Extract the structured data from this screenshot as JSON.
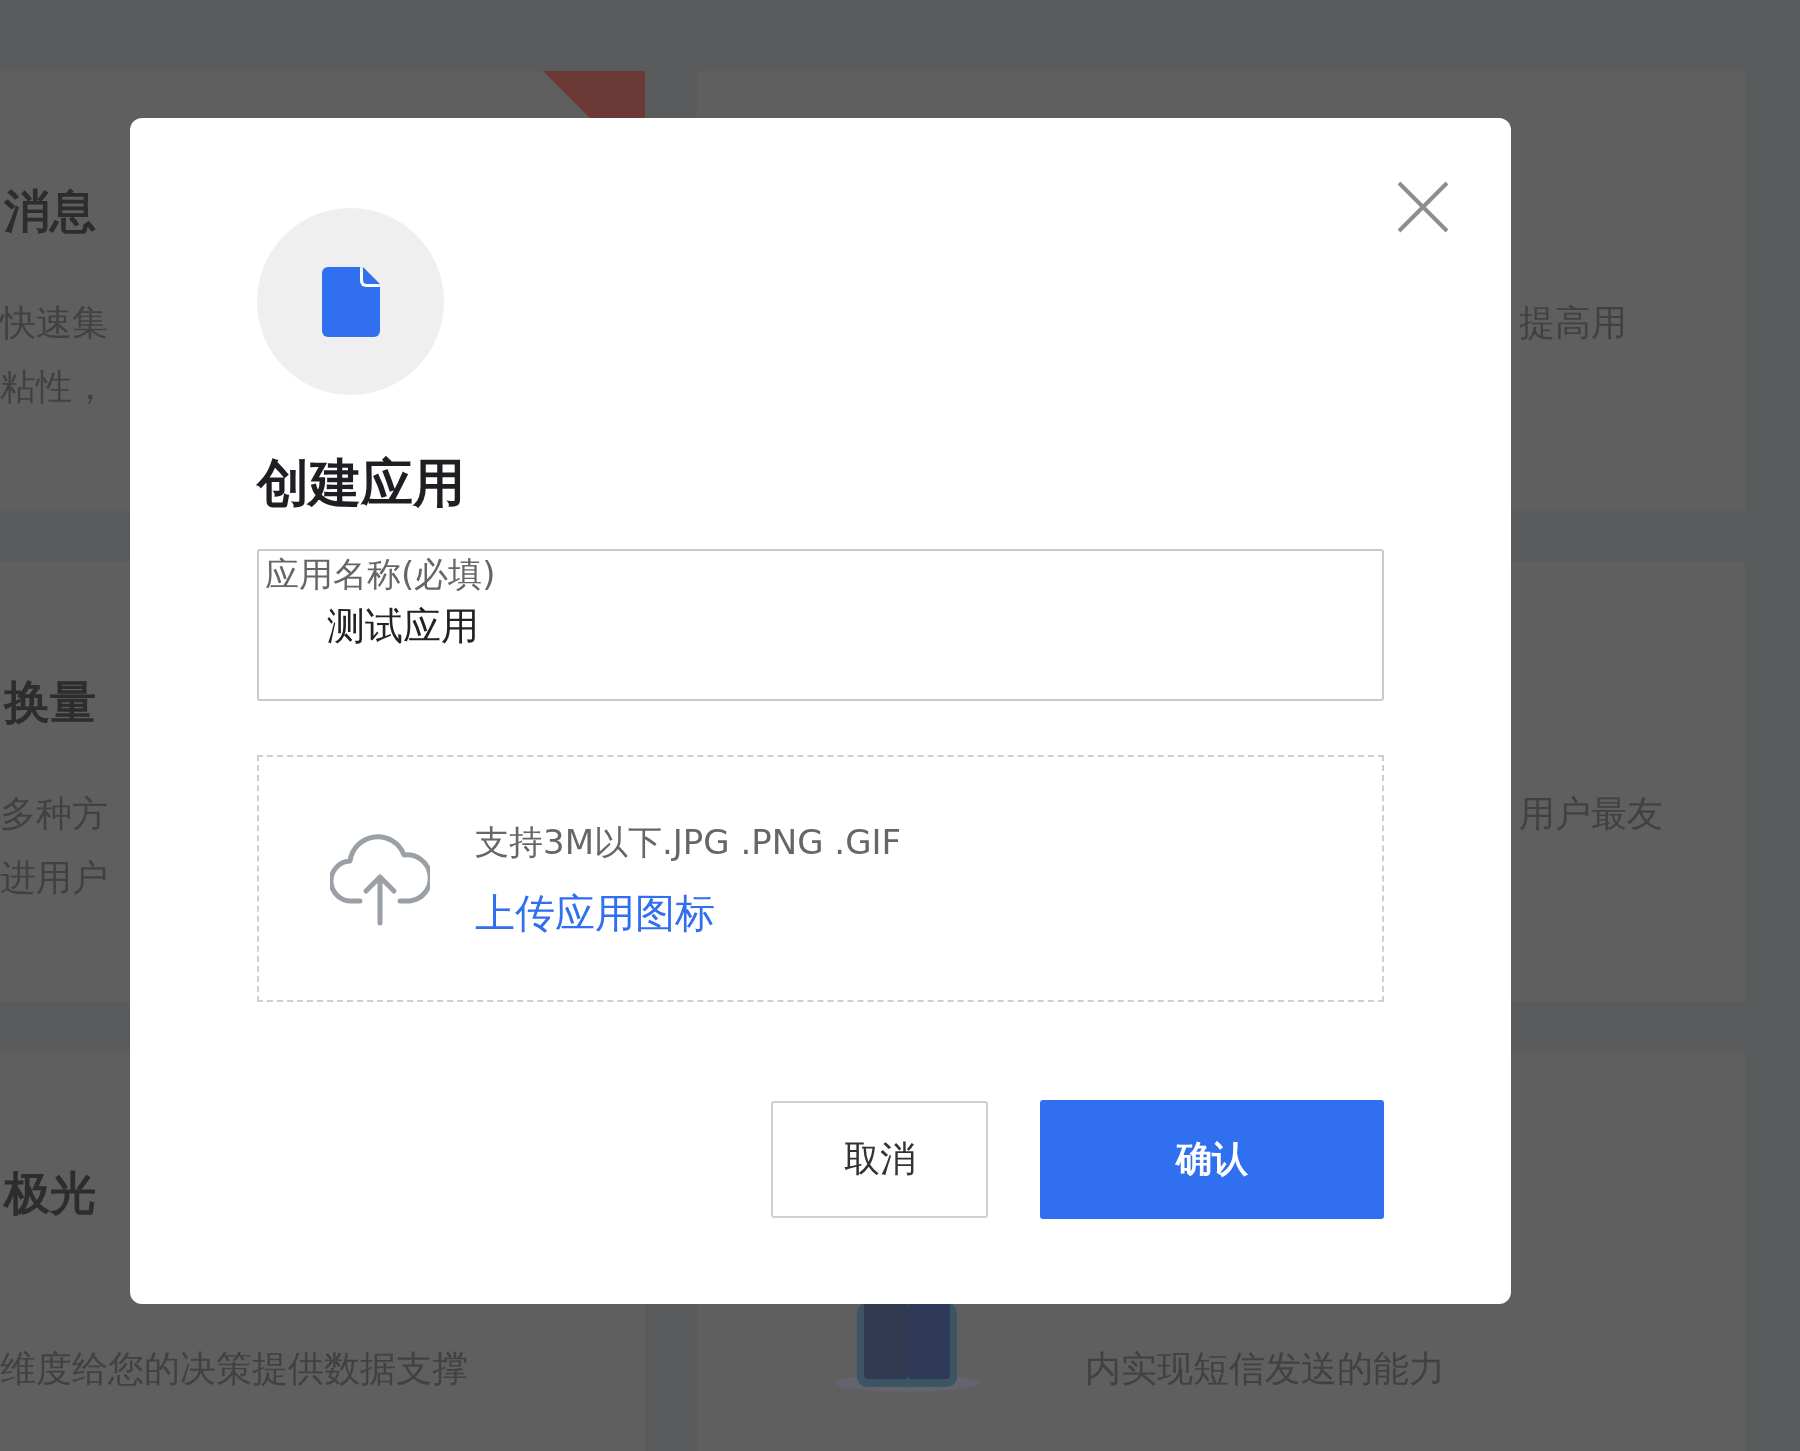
{
  "background": {
    "left_cards": [
      {
        "title": "消息",
        "lines": [
          "快速集",
          "粘性，"
        ],
        "ribbon": true
      },
      {
        "title": "换量",
        "lines": [
          "多种方",
          "进用户"
        ]
      },
      {
        "title": "极光",
        "lines": [
          "维度给您的决策提供数据支撑"
        ]
      }
    ],
    "right_cards": [
      {
        "lines": [
          "提高用"
        ]
      },
      {
        "lines": [
          "用户最友"
        ]
      },
      {
        "lines": [
          "内实现短信发送的能力"
        ]
      }
    ]
  },
  "dialog": {
    "title": "创建应用",
    "name_field": {
      "label": "应用名称(必填)",
      "value": "测试应用"
    },
    "upload": {
      "hint": "支持3M以下.JPG .PNG .GIF",
      "link": "上传应用图标"
    },
    "buttons": [
      {
        "label": "取消",
        "kind": "secondary"
      },
      {
        "label": "确认",
        "kind": "primary"
      }
    ]
  }
}
